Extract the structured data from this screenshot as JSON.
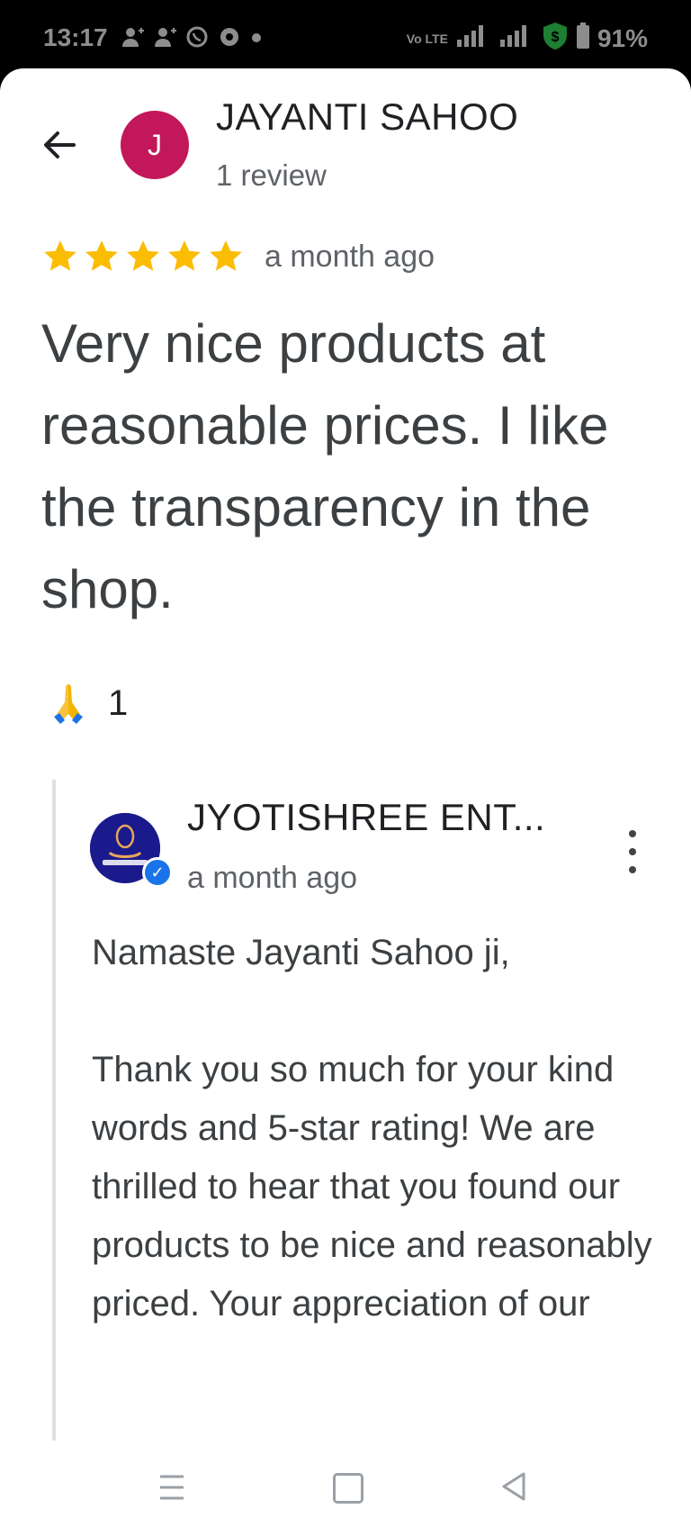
{
  "status_bar": {
    "time": "13:17",
    "battery": "91%",
    "network_label": "Vo LTE"
  },
  "review": {
    "reviewer_name": "JAYANTI SAHOO",
    "reviewer_initial": "J",
    "review_count": "1 review",
    "rating": 5,
    "time": "a month ago",
    "text": "Very nice products at reasonable prices.  I like the transparency in the shop.",
    "reaction_count": "1",
    "reaction_icon": "folded-hands-icon",
    "avatar_color": "#c2185b",
    "star_color": "#fbbc04"
  },
  "owner_reply": {
    "business_name": "JYOTISHREE ENT...",
    "time": "a month ago",
    "text": "Namaste Jayanti Sahoo ji,\n\nThank you so much for your kind words and 5-star rating! We are thrilled to hear that you found our products to be nice and reasonably priced. Your appreciation of our",
    "logo_color": "#1b1a8c",
    "verified_color": "#1a73e8"
  },
  "icons": {
    "back": "arrow-back-icon",
    "more": "more-vert-icon",
    "nav_menu": "recent-apps-icon",
    "nav_home": "home-icon",
    "nav_back": "back-triangle-icon"
  }
}
